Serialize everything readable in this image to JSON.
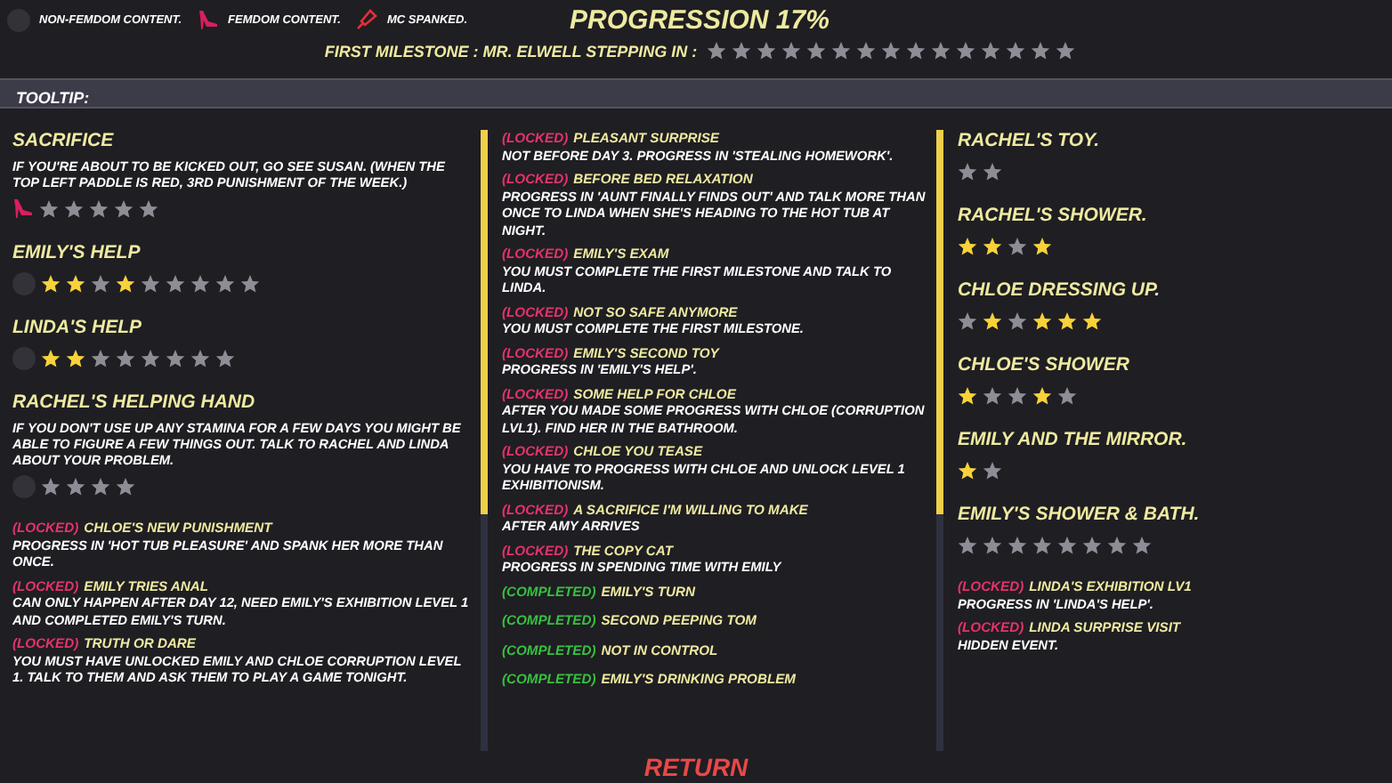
{
  "legend": [
    {
      "kind": "face",
      "label": "NON-FEMDOM CONTENT."
    },
    {
      "kind": "heel",
      "label": "FEMDOM CONTENT."
    },
    {
      "kind": "paddle",
      "label": "MC SPANKED."
    }
  ],
  "title": "PROGRESSION 17%",
  "milestone": {
    "label": "FIRST MILESTONE : MR. ELWELL STEPPING IN :",
    "star_states": [
      false,
      false,
      false,
      false,
      false,
      false,
      false,
      false,
      false,
      false,
      false,
      false,
      false,
      false,
      false
    ]
  },
  "tooltip": {
    "label": "TOOLTIP:"
  },
  "columns": [
    {
      "items": [
        {
          "kind": "heel_scene",
          "title": "SACRIFICE",
          "description": "IF YOU'RE ABOUT TO BE KICKED OUT, GO SEE SUSAN. (WHEN THE TOP LEFT PADDLE IS RED, 3RD PUNISHMENT OF THE WEEK.)",
          "star_states": [
            false,
            false,
            false,
            false,
            false
          ]
        },
        {
          "kind": "face_scene",
          "title": "EMILY'S HELP",
          "star_states": [
            true,
            true,
            false,
            true,
            false,
            false,
            false,
            false,
            false
          ]
        },
        {
          "kind": "face_scene",
          "title": "LINDA'S HELP",
          "star_states": [
            true,
            true,
            false,
            false,
            false,
            false,
            false,
            false
          ]
        },
        {
          "kind": "face_scene",
          "title": "RACHEL'S HELPING HAND",
          "description": "IF YOU DON'T USE UP ANY STAMINA FOR A FEW DAYS YOU MIGHT BE ABLE TO FIGURE A FEW THINGS OUT. TALK TO RACHEL AND LINDA ABOUT YOUR PROBLEM.",
          "star_states": [
            false,
            false,
            false,
            false
          ]
        },
        {
          "kind": "locked_event",
          "status_label": "(LOCKED)",
          "title": "CHLOE'S NEW PUNISHMENT",
          "description": "PROGRESS IN 'HOT TUB PLEASURE' AND SPANK HER MORE THAN ONCE."
        },
        {
          "kind": "locked_event",
          "status_label": "(LOCKED)",
          "title": "EMILY TRIES ANAL",
          "description": "CAN ONLY HAPPEN AFTER DAY 12, NEED EMILY'S EXHIBITION LEVEL 1 AND COMPLETED EMILY'S TURN."
        },
        {
          "kind": "locked_event",
          "status_label": "(LOCKED)",
          "title": "TRUTH OR DARE",
          "description": "YOU MUST HAVE UNLOCKED EMILY AND CHLOE CORRUPTION LEVEL 1. TALK TO THEM AND ASK THEM TO PLAY A GAME TONIGHT."
        }
      ]
    },
    {
      "items": [
        {
          "kind": "locked_event",
          "status_label": "(LOCKED)",
          "title": "PLEASANT SURPRISE",
          "description": "NOT BEFORE DAY 3. PROGRESS IN 'STEALING HOMEWORK'."
        },
        {
          "kind": "locked_event",
          "status_label": "(LOCKED)",
          "title": "BEFORE BED RELAXATION",
          "description": "PROGRESS IN 'AUNT FINALLY FINDS OUT' AND TALK MORE THAN ONCE TO LINDA WHEN SHE'S HEADING TO THE HOT TUB AT NIGHT."
        },
        {
          "kind": "locked_event",
          "status_label": "(LOCKED)",
          "title": "EMILY'S EXAM",
          "description": "YOU MUST COMPLETE THE FIRST MILESTONE AND TALK TO LINDA."
        },
        {
          "kind": "locked_event",
          "status_label": "(LOCKED)",
          "title": "NOT SO SAFE ANYMORE",
          "description": "YOU MUST COMPLETE THE FIRST MILESTONE."
        },
        {
          "kind": "locked_event",
          "status_label": "(LOCKED)",
          "title": "EMILY'S SECOND TOY",
          "description": "PROGRESS IN 'EMILY'S HELP'."
        },
        {
          "kind": "locked_event",
          "status_label": "(LOCKED)",
          "title": "SOME HELP FOR CHLOE",
          "description": "AFTER YOU MADE SOME PROGRESS WITH CHLOE (CORRUPTION LVL1). FIND HER IN THE BATHROOM."
        },
        {
          "kind": "locked_event",
          "status_label": "(LOCKED)",
          "title": "CHLOE YOU TEASE",
          "description": "YOU HAVE TO PROGRESS WITH CHLOE AND UNLOCK LEVEL 1 EXHIBITIONISM."
        },
        {
          "kind": "locked_event",
          "status_label": "(LOCKED)",
          "title": "A SACRIFICE I'M WILLING TO MAKE",
          "description": "AFTER AMY ARRIVES"
        },
        {
          "kind": "locked_event",
          "status_label": "(LOCKED)",
          "title": "THE COPY CAT",
          "description": "PROGRESS IN SPENDING TIME WITH EMILY"
        },
        {
          "kind": "completed_event",
          "status_label": "(COMPLETED)",
          "title": "EMILY'S TURN"
        },
        {
          "kind": "completed_event",
          "status_label": "(COMPLETED)",
          "title": "SECOND PEEPING TOM"
        },
        {
          "kind": "completed_event",
          "status_label": "(COMPLETED)",
          "title": "NOT IN CONTROL"
        },
        {
          "kind": "completed_event",
          "status_label": "(COMPLETED)",
          "title": "EMILY'S DRINKING PROBLEM"
        }
      ]
    },
    {
      "items": [
        {
          "kind": "scene",
          "title": "RACHEL'S TOY.",
          "star_states": [
            false,
            false
          ]
        },
        {
          "kind": "scene",
          "title": "RACHEL'S SHOWER.",
          "star_states": [
            true,
            true,
            false,
            true
          ]
        },
        {
          "kind": "scene",
          "title": "CHLOE DRESSING UP.",
          "star_states": [
            false,
            true,
            false,
            true,
            true,
            true
          ]
        },
        {
          "kind": "scene",
          "title": "CHLOE'S SHOWER",
          "star_states": [
            true,
            false,
            false,
            true,
            false
          ]
        },
        {
          "kind": "scene",
          "title": "EMILY AND THE MIRROR.",
          "star_states": [
            true,
            false
          ]
        },
        {
          "kind": "scene",
          "title": "EMILY'S SHOWER & BATH.",
          "star_states": [
            false,
            false,
            false,
            false,
            false,
            false,
            false,
            false
          ]
        },
        {
          "kind": "locked_event",
          "status_label": "(LOCKED)",
          "title": "LINDA'S EXHIBITION LV1",
          "description": "PROGRESS IN 'LINDA'S HELP'."
        },
        {
          "kind": "locked_event",
          "status_label": "(LOCKED)",
          "title": "LINDA SURPRISE VISIT",
          "description": "HIDDEN EVENT."
        }
      ]
    }
  ],
  "return_button": {
    "label": "RETURN"
  }
}
